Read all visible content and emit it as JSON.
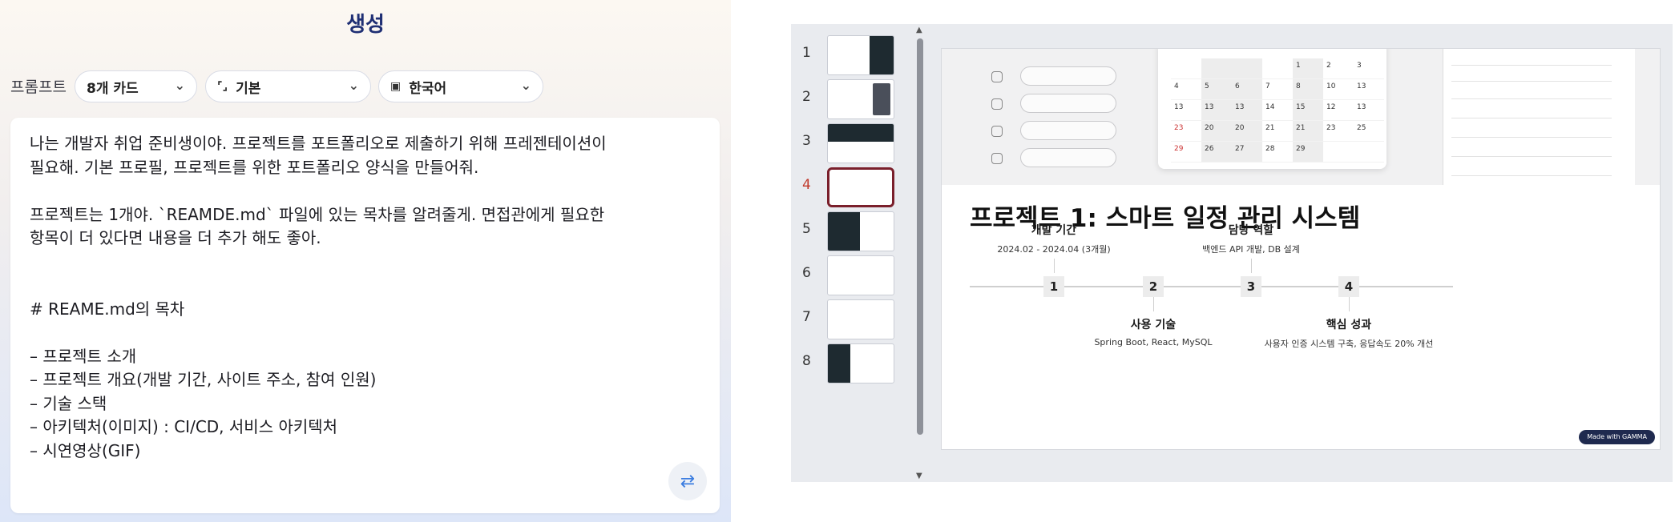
{
  "generate": {
    "title": "생성"
  },
  "prompt": {
    "label": "프롬프트",
    "cards_select": "8개 카드",
    "style_select": "기본",
    "language_select": "한국어"
  },
  "editor_lines": [
    "나는 개발자 취업 준비생이야. 프로젝트를 포트폴리오로 제출하기 위해 프레젠테이션이",
    "필요해. 기본 프로필, 프로젝트를 위한 포트폴리오 양식을 만들어줘.",
    "",
    "프로젝트는 1개야. `REAMDE.md` 파일에 있는 목차를 알려줄게. 면접관에게 필요한",
    "항목이 더 있다면 내용을 더 추가 해도 좋아.",
    "",
    "",
    "# REAME.md의 목차",
    "",
    "– 프로젝트 소개",
    "– 프로젝트 개요(개발 기간, 사이트 주소, 참여 인원)",
    "– 기술 스택",
    "– 아키텍처(이미지) : CI/CD, 서비스 아키텍처",
    "– 시연영상(GIF)"
  ],
  "thumbnails": [
    "1",
    "2",
    "3",
    "4",
    "5",
    "6",
    "7",
    "8"
  ],
  "active_thumbnail": "4",
  "slide": {
    "title": "프로젝트 1: 스마트 일정 관리 시스템",
    "steps": [
      "1",
      "2",
      "3",
      "4"
    ],
    "items": [
      {
        "heading": "개발 기간",
        "detail": "2024.02 - 2024.04 (3개월)"
      },
      {
        "heading": "사용 기술",
        "detail": "Spring Boot, React, MySQL"
      },
      {
        "heading": "담당 역할",
        "detail": "백엔드 API 개발, DB 설계"
      },
      {
        "heading": "핵심 성과",
        "detail": "사용자 인증 시스템 구축, 응답속도 20% 개선"
      }
    ],
    "badge": "Made with GAMMA"
  },
  "colors": {
    "title_navy": "#1f2f74",
    "active_thumb": "#7a1f2b",
    "badge_bg": "#1f2a4f",
    "refresh_icon": "#3b7de0"
  }
}
